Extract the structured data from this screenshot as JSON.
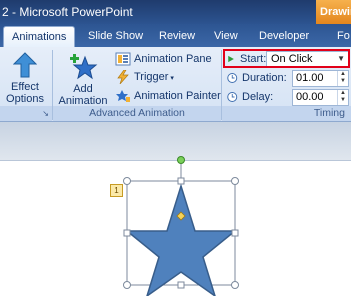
{
  "window": {
    "title": "2 - Microsoft PowerPoint",
    "context_tab": "Drawin"
  },
  "tabs": [
    "Animations",
    "Slide Show",
    "Review",
    "View",
    "Developer",
    "Fo"
  ],
  "ribbon": {
    "effect_options": {
      "line1": "Effect",
      "line2": "Options"
    },
    "add_animation": {
      "line1": "Add",
      "line2": "Animation"
    },
    "animation_pane": "Animation Pane",
    "trigger": "Trigger",
    "animation_painter": "Animation Painter",
    "advanced_group": "Advanced Animation",
    "timing_group": "Timing",
    "start_label": "Start:",
    "start_value": "On Click",
    "duration_label": "Duration:",
    "duration_value": "01.00",
    "delay_label": "Delay:",
    "delay_value": "00.00"
  },
  "slide": {
    "animation_badge": "1"
  },
  "colors": {
    "star": "#4f81bd",
    "highlight": "#e2001a",
    "context_tab": "#f0a030"
  }
}
